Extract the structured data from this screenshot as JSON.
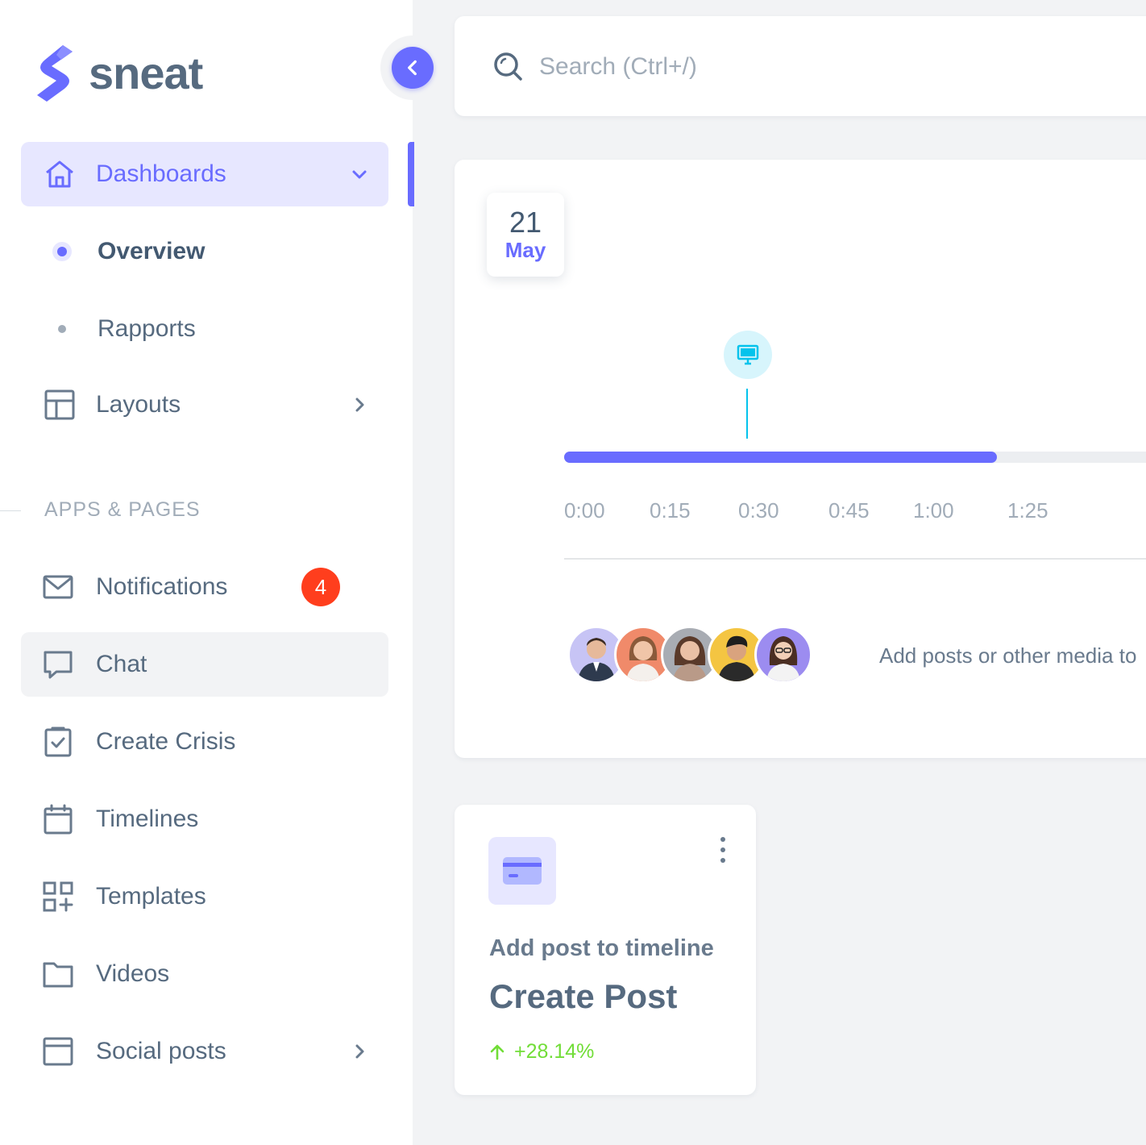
{
  "brand": {
    "name": "sneat",
    "accent": "#696cff"
  },
  "sidebar": {
    "dashboards_label": "Dashboards",
    "sub_items": [
      {
        "label": "Overview",
        "active": true
      },
      {
        "label": "Rapports",
        "active": false
      }
    ],
    "layouts_label": "Layouts",
    "section_header": "APPS & PAGES",
    "items": [
      {
        "label": "Notifications",
        "icon": "mail-icon",
        "badge": "4"
      },
      {
        "label": "Chat",
        "icon": "chat-icon"
      },
      {
        "label": "Create Crisis",
        "icon": "calendar-check-icon"
      },
      {
        "label": "Timelines",
        "icon": "calendar-icon"
      },
      {
        "label": "Templates",
        "icon": "grid-plus-icon"
      },
      {
        "label": "Videos",
        "icon": "folder-icon"
      },
      {
        "label": "Social posts",
        "icon": "window-icon"
      }
    ]
  },
  "search": {
    "placeholder": "Search (Ctrl+/)"
  },
  "timeline_card": {
    "date_day": "21",
    "date_month": "May",
    "progress_fraction": 0.707,
    "marker_icon": "desktop-icon",
    "ticks": [
      "0:00",
      "0:15",
      "0:30",
      "0:45",
      "1:00",
      "1:25"
    ],
    "media_text": "Add posts or other media to"
  },
  "post_card": {
    "icon": "credit-card-icon",
    "subtitle": "Add post to timeline",
    "title": "Create Post",
    "change": "+28.14%",
    "change_color": "#71dd37"
  }
}
